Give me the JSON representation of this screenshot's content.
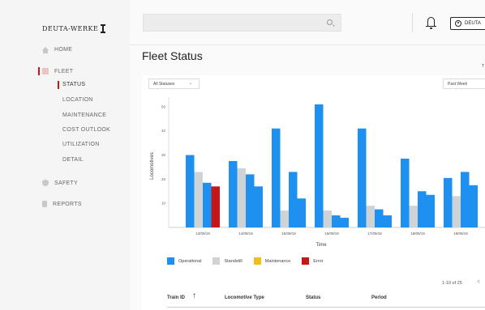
{
  "brand": {
    "logo_text": "DEUTA-WERKE"
  },
  "sidebar": {
    "items": [
      {
        "label": "HOME",
        "icon": "home-icon"
      },
      {
        "label": "FLEET",
        "icon": "train-icon"
      },
      {
        "label": "SAFETY",
        "icon": "shield-icon"
      },
      {
        "label": "REPORTS",
        "icon": "document-icon"
      }
    ],
    "fleet_sub": [
      {
        "label": "STATUS"
      },
      {
        "label": "LOCATION"
      },
      {
        "label": "MAINTENANCE"
      },
      {
        "label": "COST OUTLOOK"
      },
      {
        "label": "UTILIZATION"
      },
      {
        "label": "DETAIL"
      }
    ]
  },
  "header": {
    "user_label": "DEUTA"
  },
  "main": {
    "title": "Fleet Status",
    "right_mark": "T",
    "filters": {
      "status_select": "All Statuses",
      "period_select": "Past Week"
    },
    "pager": {
      "range": "1-10 of 25",
      "prev": "<"
    }
  },
  "table": {
    "headers": [
      "Train ID",
      "Locomotive Type",
      "Status",
      "Period"
    ]
  },
  "colors": {
    "operational": "#1e90f0",
    "standstill": "#cfd3d6",
    "maintenance": "#f2c012",
    "error": "#c21818",
    "accent": "#c21818"
  },
  "chart_data": {
    "type": "bar",
    "categories": [
      "13/09/19",
      "14/09/19",
      "15/09/19",
      "16/09/19",
      "17/09/19",
      "18/09/19",
      "19/09/19"
    ],
    "series": [
      {
        "name": "Operational",
        "values": [
          30,
          27.5,
          41,
          51,
          41,
          28.5,
          20.5
        ]
      },
      {
        "name": "Standstill",
        "values": [
          23,
          24.5,
          7,
          7,
          9,
          9,
          13
        ]
      },
      {
        "name": "Operational",
        "values": [
          18.5,
          22,
          23,
          5,
          7.5,
          15,
          23
        ]
      },
      {
        "name": "Operational",
        "values": [
          null,
          17,
          12,
          4,
          5,
          13.5,
          17.5
        ]
      },
      {
        "name": "Error",
        "values": [
          17,
          null,
          null,
          null,
          null,
          null,
          null
        ]
      }
    ],
    "legend": [
      "Operational",
      "Standstill",
      "Maintenance",
      "Error"
    ],
    "xlabel": "Time",
    "ylabel": "Locomotives",
    "yticks": [
      10,
      20,
      30,
      40,
      50
    ],
    "ylim": [
      0,
      54
    ]
  }
}
